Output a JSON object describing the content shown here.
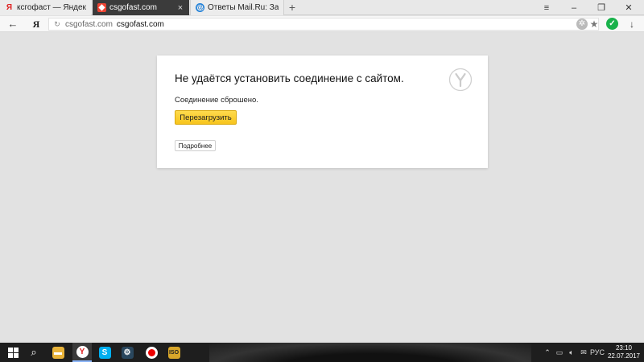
{
  "tabs": [
    {
      "title": "ксгофаст — Яндекс: нашла",
      "favicon": "yandex-icon"
    },
    {
      "title": "csgofast.com",
      "favicon": "csgofast-icon",
      "close": "×"
    },
    {
      "title": "Ответы Mail.Ru: Задать воп",
      "favicon": "mailru-icon"
    }
  ],
  "toolbar": {
    "back": "←",
    "ya": "Я",
    "domain": "csgofast.com",
    "url": "csgofast.com",
    "new_tab": "+",
    "menu": "≡",
    "minimize": "–",
    "restore": "❐",
    "close": "✕"
  },
  "error": {
    "title": "Не удаётся установить соединение с сайтом.",
    "message": "Соединение сброшено.",
    "reload_button": "Перезагрузить",
    "details_button": "Подробнее"
  },
  "taskbar": {
    "language": "РУС",
    "time": "23:10",
    "date": "22.07.2017"
  },
  "colors": {
    "page_bg": "#e2e2e2",
    "reload_button": "#f7c41c",
    "active_tab": "#3b3b3b",
    "shield": "#19b24b"
  }
}
